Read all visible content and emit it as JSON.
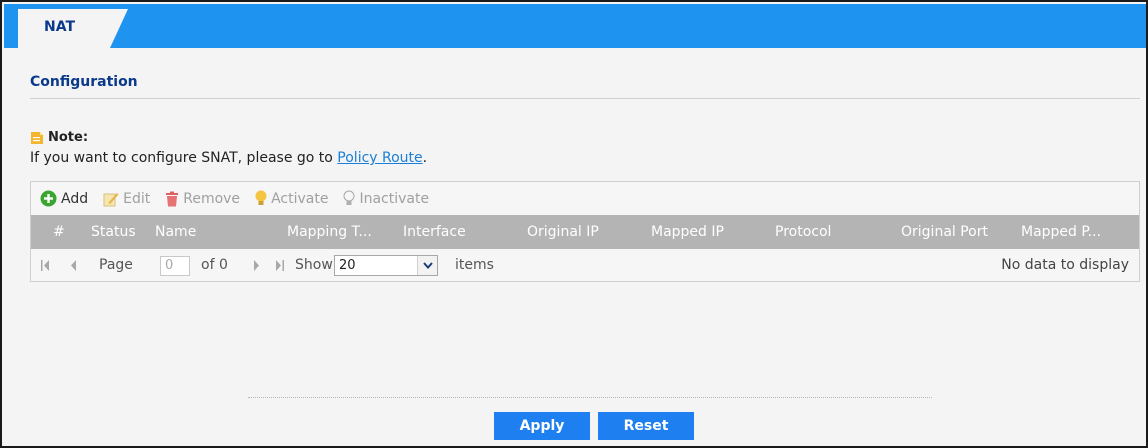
{
  "tabs": [
    {
      "label": "NAT"
    }
  ],
  "section": {
    "title": "Configuration"
  },
  "note": {
    "label": "Note:",
    "text_before": "If you want to configure SNAT, please go to ",
    "link_text": "Policy Route",
    "text_after": "."
  },
  "toolbar": {
    "add": "Add",
    "edit": "Edit",
    "remove": "Remove",
    "activate": "Activate",
    "inactivate": "Inactivate"
  },
  "table": {
    "columns": [
      "#",
      "Status",
      "Name",
      "Mapping T...",
      "Interface",
      "Original IP",
      "Mapped IP",
      "Protocol",
      "Original Port",
      "Mapped P..."
    ]
  },
  "pager": {
    "page_label": "Page",
    "page_value": "0",
    "of_label": "of 0",
    "show_label": "Show",
    "show_value": "20",
    "items_label": "items",
    "empty_text": "No data to display"
  },
  "actions": {
    "apply": "Apply",
    "reset": "Reset"
  },
  "colors": {
    "tabbar": "#1e93f0",
    "accent": "#1e7ff0",
    "title": "#0b3a8c",
    "header": "#b4b4b4"
  }
}
